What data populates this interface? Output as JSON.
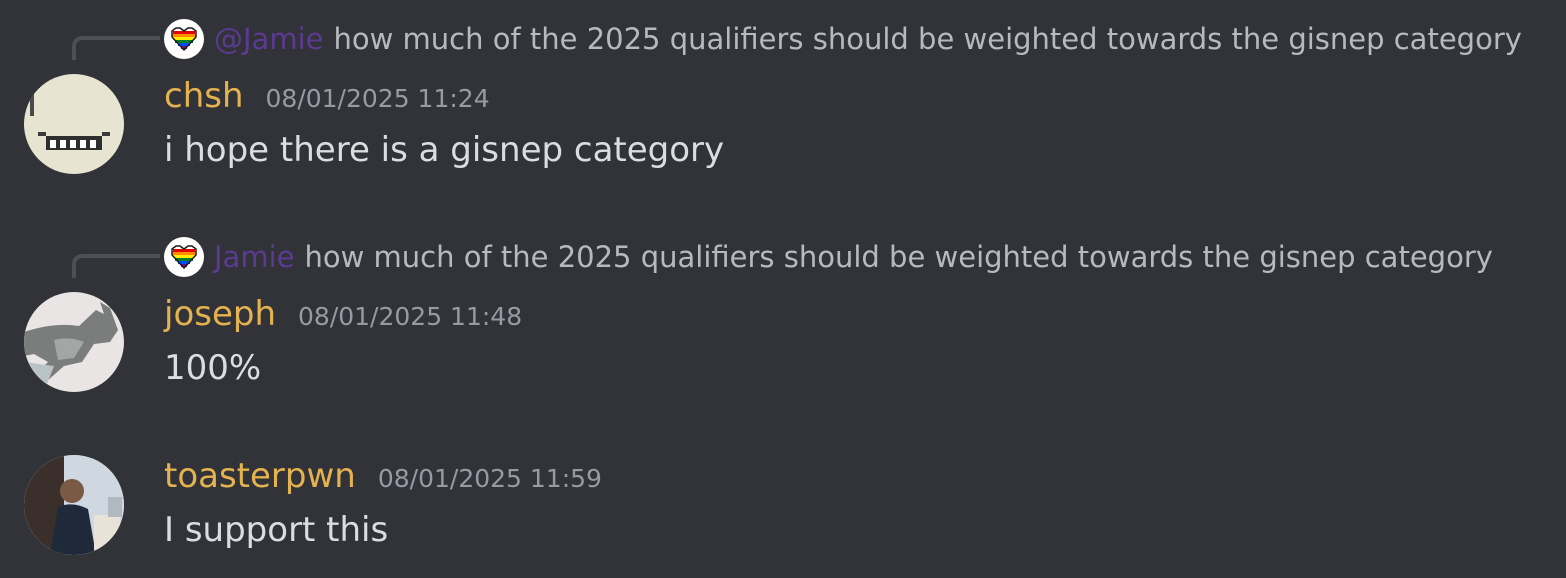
{
  "colors": {
    "background": "#313338",
    "username": "#e4b24e",
    "mention": "#5b3a91",
    "timestamp": "#949ba4",
    "reply_text": "#b5bac1",
    "content_text": "#dbdee1",
    "reply_connector": "#4e5058"
  },
  "messages": [
    {
      "reply": {
        "icon": "rainbow-heart-icon",
        "author": "@Jamie",
        "text": "how much of the 2025 qualifiers should be weighted towards the gisnep category"
      },
      "avatar": "smile-avatar",
      "username": "chsh",
      "timestamp": "08/01/2025 11:24",
      "content": "i hope there is a gisnep category"
    },
    {
      "reply": {
        "icon": "rainbow-heart-icon",
        "author": "Jamie",
        "text": "how much of the 2025 qualifiers should be weighted towards the gisnep category"
      },
      "avatar": "wolf-avatar",
      "username": "joseph",
      "timestamp": "08/01/2025 11:48",
      "content": "100%"
    },
    {
      "avatar": "person-photo-avatar",
      "username": "toasterpwn",
      "timestamp": "08/01/2025 11:59",
      "content": "I support this"
    }
  ]
}
